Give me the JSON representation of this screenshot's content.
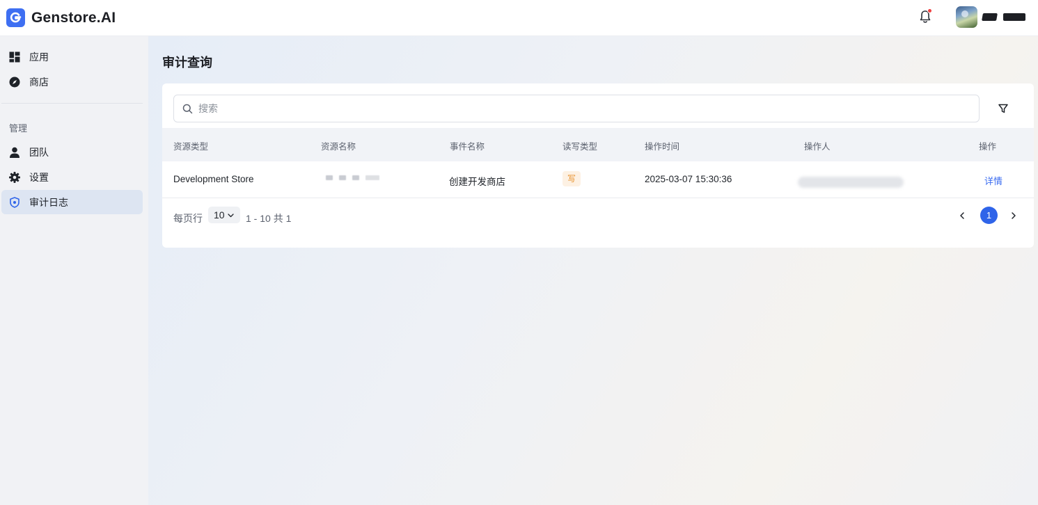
{
  "app": {
    "brand": "Genstore.AI"
  },
  "colors": {
    "accent": "#2f64e9",
    "logo": "#3e6ff2",
    "write_tag_text": "#e7902a",
    "write_tag_bg": "#fdf1e3",
    "notification_dot": "#ef4141"
  },
  "sidebar": {
    "items": [
      {
        "label": "应用",
        "icon": "dashboard-icon"
      },
      {
        "label": "商店",
        "icon": "compass-icon"
      }
    ],
    "section_label": "管理",
    "manage_items": [
      {
        "label": "团队",
        "icon": "person-icon"
      },
      {
        "label": "设置",
        "icon": "gear-icon"
      },
      {
        "label": "审计日志",
        "icon": "shield-icon",
        "active": true
      }
    ]
  },
  "page": {
    "title": "审计查询"
  },
  "search": {
    "placeholder": "搜索",
    "value": ""
  },
  "table": {
    "columns": [
      "资源类型",
      "资源名称",
      "事件名称",
      "读写类型",
      "操作时间",
      "操作人",
      "操作"
    ],
    "rows": [
      {
        "resource_type": "Development Store",
        "resource_name": "",
        "event_name": "创建开发商店",
        "rw_type": "写",
        "time": "2025-03-07 15:30:36",
        "operator": "",
        "action": "详情"
      }
    ]
  },
  "pagination": {
    "rows_per_page_label": "每页行",
    "rows_per_page": "10",
    "range": "1 - 10 共 1",
    "current_page": "1"
  }
}
